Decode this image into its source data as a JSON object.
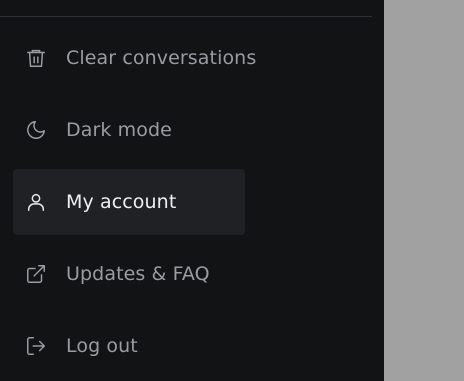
{
  "menu": {
    "items": [
      {
        "label": "Clear conversations",
        "icon": "trash-icon"
      },
      {
        "label": "Dark mode",
        "icon": "moon-icon"
      },
      {
        "label": "My account",
        "icon": "user-icon",
        "active": true
      },
      {
        "label": "Updates & FAQ",
        "icon": "external-link-icon"
      },
      {
        "label": "Log out",
        "icon": "log-out-icon"
      }
    ]
  },
  "colors": {
    "sidebar_bg": "#121315",
    "active_bg": "#202124",
    "overlay": "#a1a1a1",
    "text_muted": "#9a9ca2",
    "text_active": "#eef0f3"
  }
}
